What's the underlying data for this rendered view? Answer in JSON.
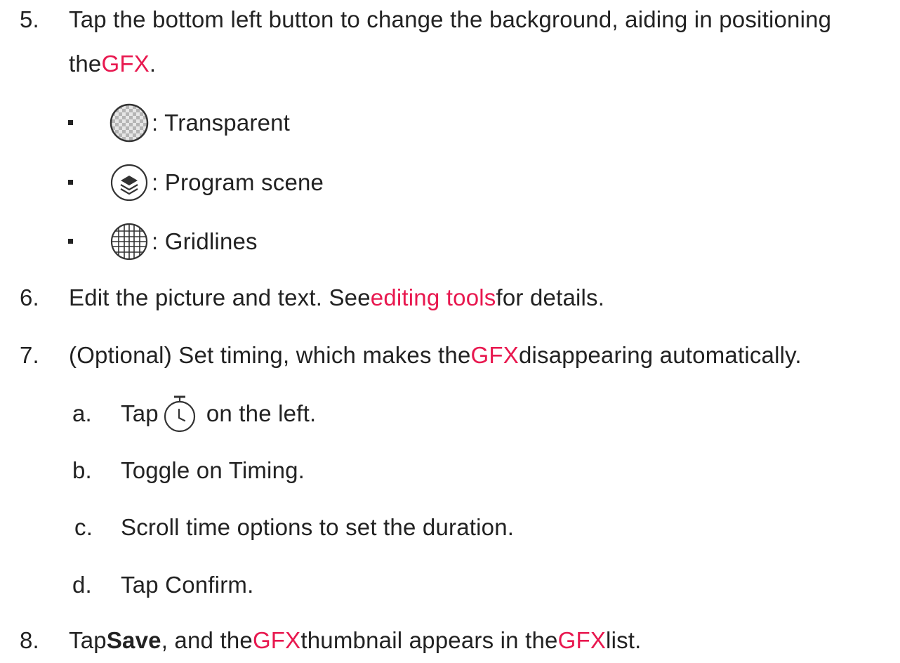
{
  "steps": [
    {
      "number": "5.",
      "text_a": "Tap the bottom left button to change the background, aiding in positioning",
      "text_b_prefix": "the ",
      "text_b_hl": "GFX",
      "text_b_suffix": ".",
      "bullets": [
        {
          "icon": "transparent-icon",
          "label": ": Transparent"
        },
        {
          "icon": "layers-icon",
          "label": ": Program scene"
        },
        {
          "icon": "grid-icon",
          "label": ": Gridlines"
        }
      ]
    },
    {
      "number": "6.",
      "prefix": "Edit the picture and text. See ",
      "link": "editing tools",
      "suffix": " for details."
    },
    {
      "number": "7.",
      "prefix": "(Optional) Set timing, which makes the ",
      "hl": "GFX",
      "suffix": " disappearing automatically.",
      "substeps": [
        {
          "marker": "a.",
          "prefix": "Tap ",
          "icon": "timer-icon",
          "suffix": " on the left."
        },
        {
          "marker": "b.",
          "text": "Toggle on Timing."
        },
        {
          "marker": "c.",
          "text": "Scroll time options to set the duration."
        },
        {
          "marker": "d.",
          "text": "Tap Confirm."
        }
      ]
    },
    {
      "number": "8.",
      "prefix": "Tap ",
      "bold": "Save",
      "middle": ", and the ",
      "hl1": "GFX",
      "middle2": " thumbnail appears in the ",
      "hl2": "GFX",
      "suffix": " list."
    }
  ],
  "colors": {
    "highlight": "#e8184f",
    "text": "#222222"
  }
}
